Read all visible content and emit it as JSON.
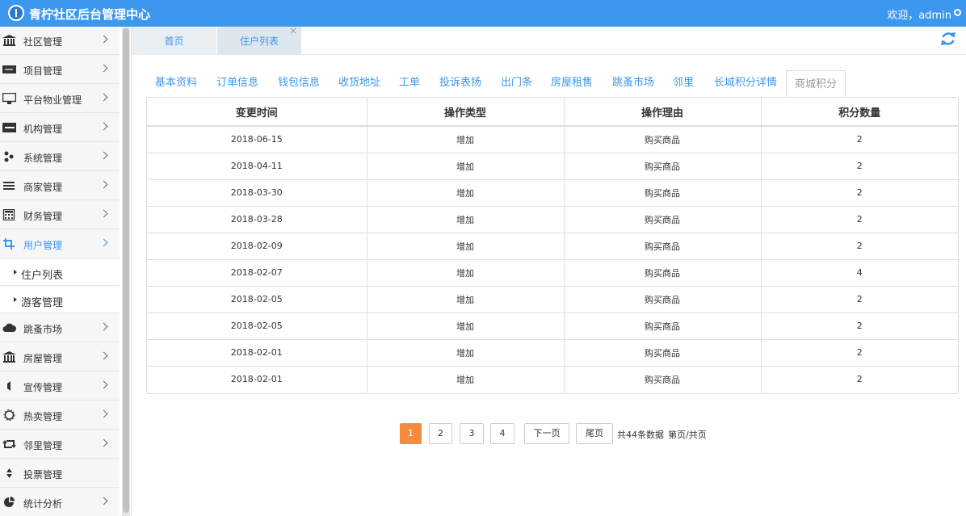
{
  "header": {
    "title": "青柠社区后台管理中心",
    "welcome": "欢迎，admin"
  },
  "sidebar": {
    "items": [
      {
        "label": "社区管理",
        "icon": "bank-icon"
      },
      {
        "label": "项目管理",
        "icon": "card-icon"
      },
      {
        "label": "平台物业管理",
        "icon": "monitor-icon"
      },
      {
        "label": "机构管理",
        "icon": "stripe-icon"
      },
      {
        "label": "系统管理",
        "icon": "yelp-icon"
      },
      {
        "label": "商家管理",
        "icon": "list-icon"
      },
      {
        "label": "财务管理",
        "icon": "calculator-icon"
      },
      {
        "label": "用户管理",
        "icon": "crop-icon",
        "active": true
      }
    ],
    "subitems": [
      {
        "label": "住户列表"
      },
      {
        "label": "游客管理"
      }
    ],
    "items2": [
      {
        "label": "跳蚤市场",
        "icon": "cloud-icon"
      },
      {
        "label": "房屋管理",
        "icon": "bank-icon"
      },
      {
        "label": "宣传管理",
        "icon": "volume-icon"
      },
      {
        "label": "热卖管理",
        "icon": "sun-icon"
      },
      {
        "label": "邻里管理",
        "icon": "retweet-icon"
      },
      {
        "label": "投票管理",
        "icon": "sort-icon"
      },
      {
        "label": "统计分析",
        "icon": "pie-chart-icon"
      }
    ]
  },
  "page_tabs": [
    {
      "label": "首页"
    },
    {
      "label": "住户列表",
      "close": "×"
    }
  ],
  "sub_tabs": [
    "基本资料",
    "订单信息",
    "钱包信息",
    "收货地址",
    "工单",
    "投诉表扬",
    "出门条",
    "房屋租售",
    "跳蚤市场",
    "邻里",
    "长城积分详情",
    "商城积分"
  ],
  "table": {
    "headers": [
      "变更时间",
      "操作类型",
      "操作理由",
      "积分数量"
    ],
    "rows": [
      [
        "2018-06-15",
        "增加",
        "购买商品",
        "2"
      ],
      [
        "2018-04-11",
        "增加",
        "购买商品",
        "2"
      ],
      [
        "2018-03-30",
        "增加",
        "购买商品",
        "2"
      ],
      [
        "2018-03-28",
        "增加",
        "购买商品",
        "2"
      ],
      [
        "2018-02-09",
        "增加",
        "购买商品",
        "2"
      ],
      [
        "2018-02-07",
        "增加",
        "购买商品",
        "4"
      ],
      [
        "2018-02-05",
        "增加",
        "购买商品",
        "2"
      ],
      [
        "2018-02-05",
        "增加",
        "购买商品",
        "2"
      ],
      [
        "2018-02-01",
        "增加",
        "购买商品",
        "2"
      ],
      [
        "2018-02-01",
        "增加",
        "购买商品",
        "2"
      ]
    ]
  },
  "pagination": {
    "pages": [
      "1",
      "2",
      "3",
      "4"
    ],
    "next": "下一页",
    "last": "尾页",
    "total": "共44条数据",
    "page_info": "第页/共页"
  },
  "colors": {
    "primary": "#3c97ef",
    "active_page": "#f68b3b"
  }
}
